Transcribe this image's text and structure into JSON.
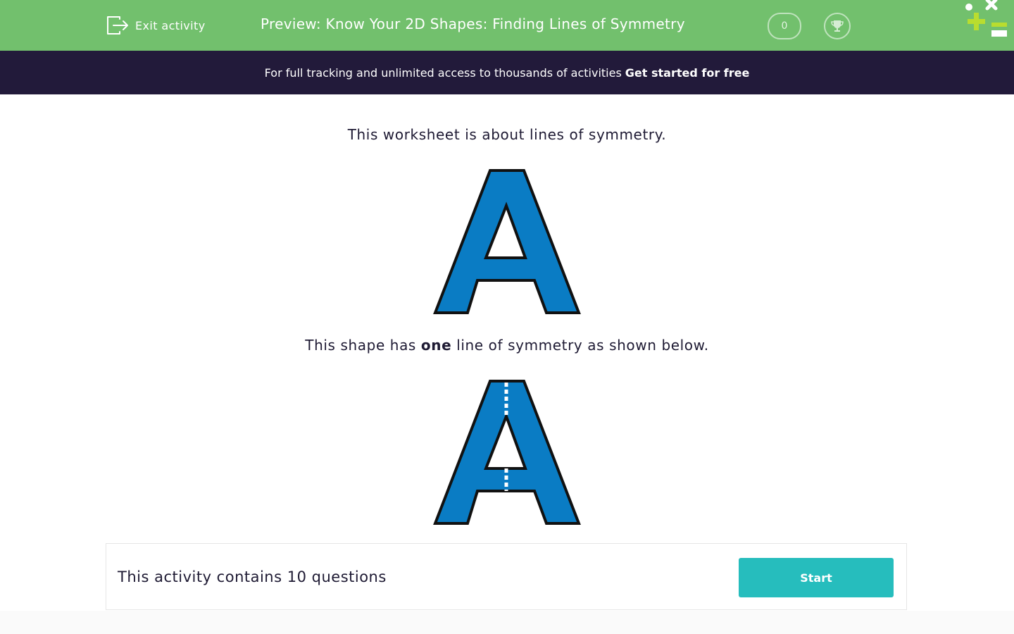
{
  "header": {
    "exit_label": "Exit activity",
    "title": "Preview: Know Your 2D Shapes: Finding Lines of Symmetry",
    "score": "0",
    "icons": [
      "exit-icon",
      "trophy-icon",
      "logo-icon"
    ]
  },
  "banner": {
    "text": "For full tracking and unlimited access to thousands of activities",
    "link": "Get started for free"
  },
  "content": {
    "intro": "This worksheet is about lines of symmetry.",
    "desc_before": "This shape has ",
    "desc_bold": "one",
    "desc_after": " line of symmetry as shown below."
  },
  "footer": {
    "question_count": "This activity contains 10 questions",
    "start_label": "Start"
  },
  "colors": {
    "header_green": "#72c06d",
    "banner_dark": "#221a3a",
    "shape_blue": "#0a7cc4",
    "button_teal": "#26bdbd",
    "logo_lime": "#b9dd2f"
  }
}
